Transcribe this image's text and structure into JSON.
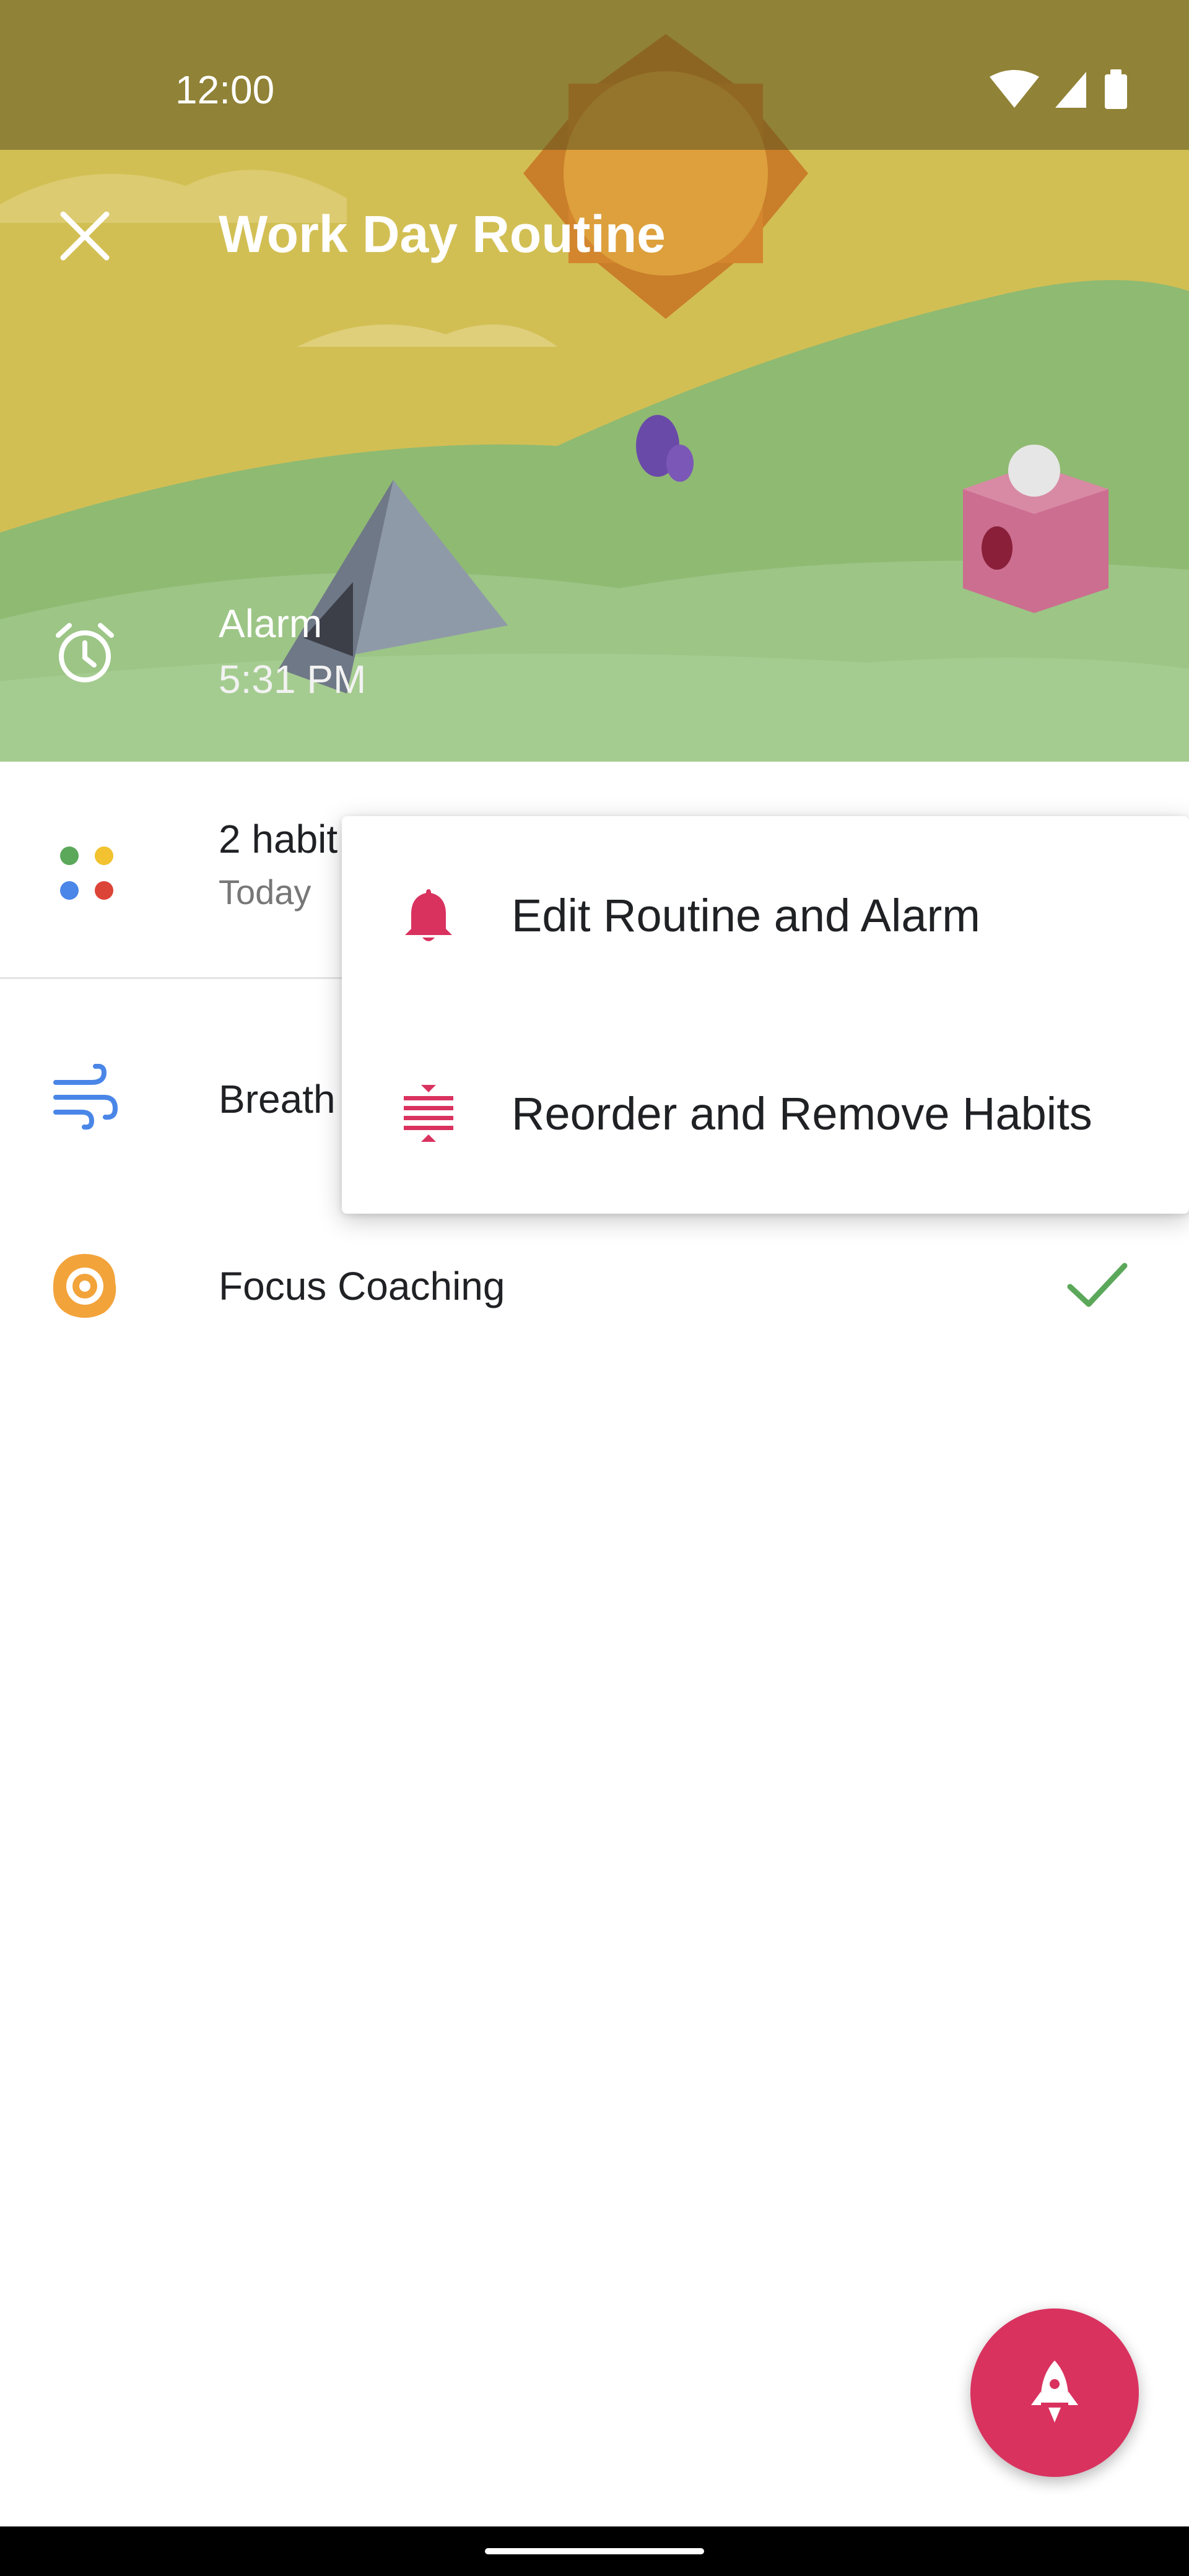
{
  "status_bar": {
    "time": "12:00"
  },
  "app_bar": {
    "title": "Work Day Routine"
  },
  "alarm": {
    "label": "Alarm",
    "time": "5:31 PM"
  },
  "summary": {
    "title": "2 habit",
    "subtitle": "Today"
  },
  "habits": [
    {
      "label": "Breath",
      "icon": "wind-icon"
    },
    {
      "label": "Focus Coaching",
      "icon": "focus-target-icon",
      "completed": true
    }
  ],
  "menu": {
    "items": [
      {
        "label": "Edit Routine and Alarm",
        "icon": "bell-icon"
      },
      {
        "label": "Reorder and Remove Habits",
        "icon": "reorder-icon"
      }
    ]
  },
  "colors": {
    "accent": "#d9325f",
    "habit_icon_blue": "#4a86e8",
    "habit_icon_orange": "#f2a33a",
    "check": "#5ba85b"
  }
}
